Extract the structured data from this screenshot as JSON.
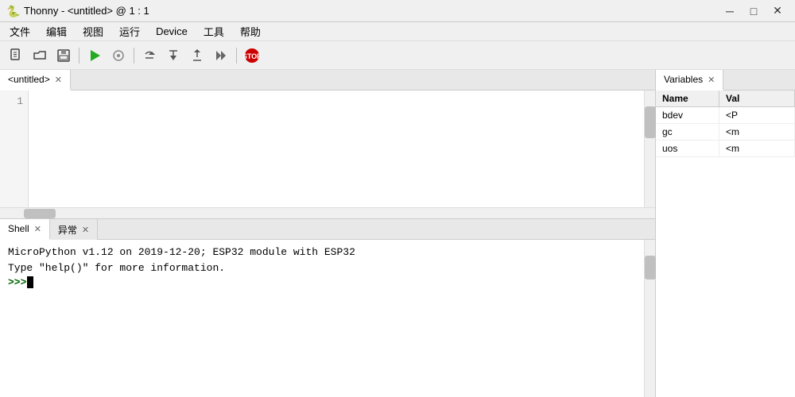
{
  "titleBar": {
    "icon": "🐍",
    "title": "Thonny  -  <untitled>  @  1 : 1",
    "minimize": "─",
    "maximize": "□",
    "close": "✕"
  },
  "menuBar": {
    "items": [
      "文件",
      "编辑",
      "视图",
      "运行",
      "Device",
      "工具",
      "帮助"
    ]
  },
  "toolbar": {
    "buttons": [
      {
        "icon": "📄",
        "name": "new"
      },
      {
        "icon": "📂",
        "name": "open"
      },
      {
        "icon": "💾",
        "name": "save"
      },
      {
        "icon": "▶",
        "name": "run"
      },
      {
        "icon": "⏸",
        "name": "debug"
      },
      {
        "icon": "↩",
        "name": "step-over"
      },
      {
        "icon": "↪",
        "name": "step-into"
      },
      {
        "icon": "⏏",
        "name": "step-out"
      },
      {
        "icon": "▷",
        "name": "resume"
      },
      {
        "icon": "⏹",
        "name": "stop"
      }
    ]
  },
  "editor": {
    "tabLabel": "<untitled>",
    "lineNumbers": [
      "1"
    ],
    "content": ""
  },
  "shell": {
    "tabLabel": "Shell",
    "tab2Label": "异常",
    "lines": [
      "MicroPython v1.12 on 2019-12-20; ESP32 module with ESP32",
      "Type \"help()\" for more information."
    ],
    "prompt": ">>>"
  },
  "variables": {
    "tabLabel": "Variables",
    "columns": {
      "name": "Name",
      "value": "Val"
    },
    "rows": [
      {
        "name": "bdev",
        "value": "<P"
      },
      {
        "name": "gc",
        "value": "<m"
      },
      {
        "name": "uos",
        "value": "<m"
      }
    ]
  }
}
